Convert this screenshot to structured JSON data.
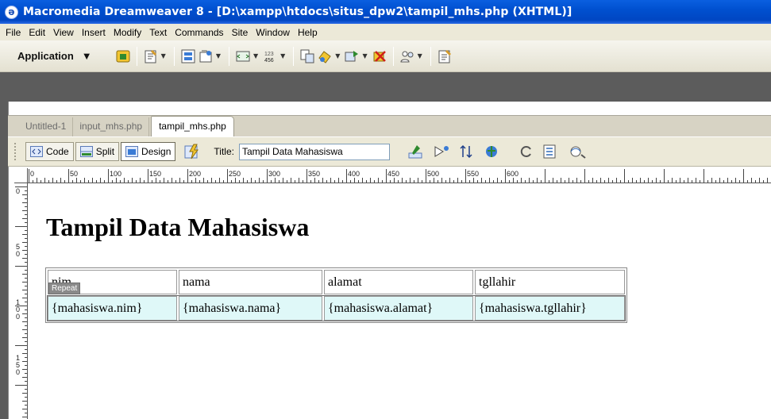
{
  "window": {
    "title": "Macromedia Dreamweaver 8 - [D:\\xampp\\htdocs\\situs_dpw2\\tampil_mhs.php (XHTML)]"
  },
  "menu": [
    "File",
    "Edit",
    "View",
    "Insert",
    "Modify",
    "Text",
    "Commands",
    "Site",
    "Window",
    "Help"
  ],
  "app_toolbar": {
    "workspace_label": "Application"
  },
  "doc_tabs": {
    "items": [
      "Untitled-1",
      "input_mhs.php",
      "tampil_mhs.php"
    ],
    "active": "tampil_mhs.php"
  },
  "doc_toolbar": {
    "code_label": "Code",
    "split_label": "Split",
    "design_label": "Design",
    "title_label": "Title:",
    "title_value": "Tampil Data Mahasiswa"
  },
  "ruler": {
    "h_labels": [
      "0",
      "50",
      "100",
      "150",
      "200",
      "250",
      "300",
      "350",
      "400",
      "450",
      "500",
      "550",
      "600"
    ],
    "v_labels": [
      "0",
      "50",
      "100",
      "150"
    ]
  },
  "page": {
    "heading": "Tampil Data Mahasiswa",
    "table": {
      "headers": [
        "nim",
        "nama",
        "alamat",
        "tgllahir"
      ],
      "row": [
        "{mahasiswa.nim}",
        "{mahasiswa.nama}",
        "{mahasiswa.alamat}",
        "{mahasiswa.tgllahir}"
      ]
    },
    "repeat_tag": "Repeat"
  }
}
